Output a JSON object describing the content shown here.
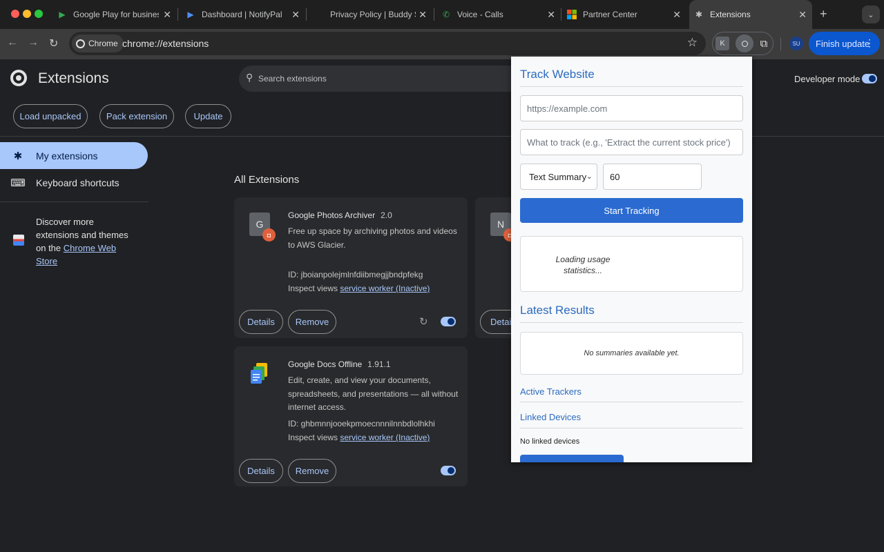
{
  "tabs": [
    {
      "title": "Google Play for business |",
      "favicon": "play-icon"
    },
    {
      "title": "Dashboard | NotifyPal",
      "favicon": "notifypal-icon"
    },
    {
      "title": "Privacy Policy | Buddy Sui",
      "favicon": "blank-icon"
    },
    {
      "title": "Voice - Calls",
      "favicon": "phone-icon"
    },
    {
      "title": "Partner Center",
      "favicon": "microsoft-icon"
    },
    {
      "title": "Extensions",
      "favicon": "puzzle-icon"
    }
  ],
  "toolbar": {
    "chip_label": "Chrome",
    "url": "chrome://extensions",
    "avatar_initials": "SU",
    "finish_update": "Finish update"
  },
  "page": {
    "title": "Extensions",
    "search_placeholder": "Search extensions",
    "developer_mode": "Developer mode",
    "buttons": {
      "load_unpacked": "Load unpacked",
      "pack_extension": "Pack extension",
      "update": "Update"
    }
  },
  "sidebar": {
    "items": [
      {
        "label": "My extensions",
        "icon": "puzzle-icon"
      },
      {
        "label": "Keyboard shortcuts",
        "icon": "keyboard-icon"
      }
    ],
    "discover_text": "Discover more extensions and themes on the",
    "discover_link": "Chrome Web Store"
  },
  "section_title": "All Extensions",
  "extensions": [
    {
      "icon_letter": "G",
      "name": "Google Photos Archiver",
      "version": "2.0",
      "description": "Free up space by archiving photos and videos to AWS Glacier.",
      "id": "ID: jboianpolejmlnfdiibmegjjbndpfekg",
      "inspect": "Inspect views",
      "inspect_link": "service worker (Inactive)",
      "details": "Details",
      "remove": "Remove",
      "enabled": true
    },
    {
      "icon_letter": "N",
      "details": "Details"
    },
    {
      "name": "Google Docs Offline",
      "version": "1.91.1",
      "description": "Edit, create, and view your documents, spreadsheets, and presentations — all without internet access.",
      "id": "ID: ghbmnnjooekpmoecnnnilnnbdlolhkhi",
      "inspect": "Inspect views",
      "inspect_link": "service worker (Inactive)",
      "details": "Details",
      "remove": "Remove",
      "enabled": true
    }
  ],
  "popup": {
    "title": "Track Website",
    "url_placeholder": "https://example.com",
    "what_placeholder": "What to track (e.g., 'Extract the current stock price')",
    "mode_selected": "Text Summary",
    "interval": "60",
    "start_button": "Start Tracking",
    "usage_text": "Loading usage statistics...",
    "latest_results": "Latest Results",
    "no_summaries": "No summaries available yet.",
    "active_trackers": "Active Trackers",
    "linked_devices": "Linked Devices",
    "no_linked": "No linked devices"
  },
  "colors": {
    "accent": "#a8c7fa",
    "popup_heading": "#2b6bbf",
    "popup_button": "#2b6bd1",
    "finish_update": "#0b57d0"
  }
}
